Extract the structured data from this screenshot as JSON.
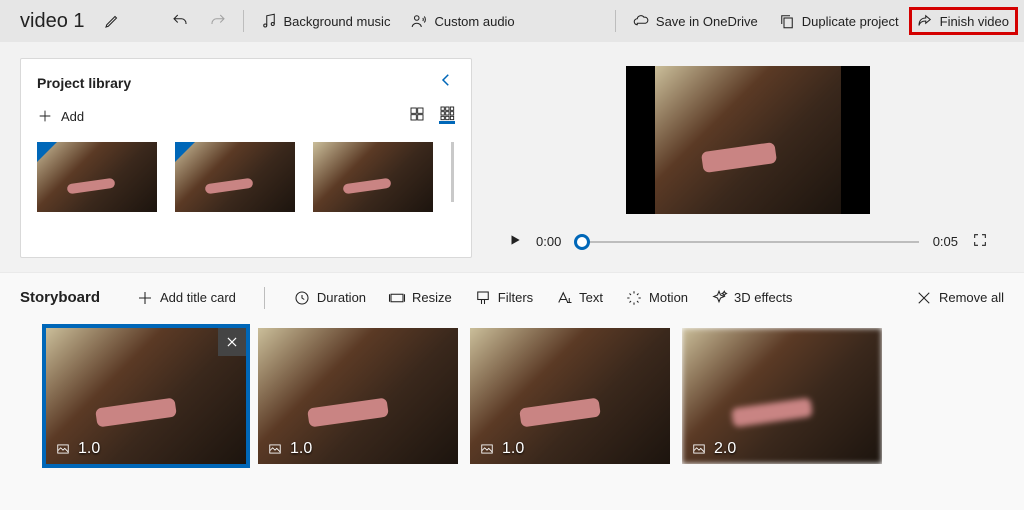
{
  "top": {
    "title": "video 1",
    "bg_music": "Background music",
    "custom_audio": "Custom audio",
    "save": "Save in OneDrive",
    "duplicate": "Duplicate project",
    "finish": "Finish video"
  },
  "library": {
    "title": "Project library",
    "add": "Add"
  },
  "player": {
    "current": "0:00",
    "total": "0:05"
  },
  "storyboard": {
    "title": "Storyboard",
    "add_title": "Add title card",
    "duration": "Duration",
    "resize": "Resize",
    "filters": "Filters",
    "text": "Text",
    "motion": "Motion",
    "effects": "3D effects",
    "remove": "Remove all",
    "clips": [
      {
        "dur": "1.0",
        "selected": true
      },
      {
        "dur": "1.0",
        "selected": false
      },
      {
        "dur": "1.0",
        "selected": false
      },
      {
        "dur": "2.0",
        "selected": false,
        "blur": true
      }
    ]
  }
}
